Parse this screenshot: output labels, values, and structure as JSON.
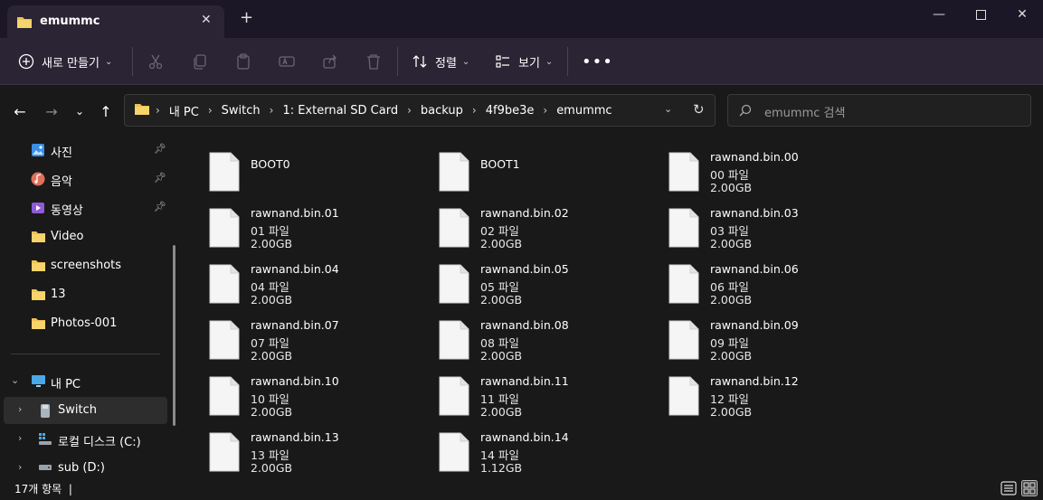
{
  "window": {
    "tab_title": "emummc",
    "new_tab_icon": "plus-icon",
    "controls": [
      "minimize-icon",
      "maximize-icon",
      "close-icon"
    ]
  },
  "toolbar": {
    "new_label": "새로 만들기",
    "sort_label": "정렬",
    "view_label": "보기",
    "more_icon": "more-icon"
  },
  "address": {
    "crumbs": [
      "내 PC",
      "Switch",
      "1: External SD Card",
      "backup",
      "4f9be3e",
      "emummc"
    ],
    "search_placeholder": "emummc 검색"
  },
  "sidebar": {
    "quick_access": [
      {
        "label": "사진",
        "icon": "pictures-icon",
        "pinned": true
      },
      {
        "label": "음악",
        "icon": "music-icon",
        "pinned": true
      },
      {
        "label": "동영상",
        "icon": "videos-icon",
        "pinned": true
      },
      {
        "label": "Video",
        "icon": "folder-icon",
        "pinned": false
      },
      {
        "label": "screenshots",
        "icon": "folder-icon",
        "pinned": false
      },
      {
        "label": "13",
        "icon": "folder-icon",
        "pinned": false
      },
      {
        "label": "Photos-001",
        "icon": "folder-icon",
        "pinned": false
      }
    ],
    "this_pc": "내 PC",
    "drives": [
      {
        "label": "Switch",
        "icon": "sd-card-icon",
        "selected": true
      },
      {
        "label": "로컬 디스크 (C:)",
        "icon": "windows-drive-icon",
        "selected": false
      },
      {
        "label": "sub (D:)",
        "icon": "drive-icon",
        "selected": false
      }
    ]
  },
  "files": [
    {
      "name": "BOOT0",
      "type": "",
      "size": ""
    },
    {
      "name": "BOOT1",
      "type": "",
      "size": ""
    },
    {
      "name": "rawnand.bin.00",
      "type": "00 파일",
      "size": "2.00GB"
    },
    {
      "name": "rawnand.bin.01",
      "type": "01 파일",
      "size": "2.00GB"
    },
    {
      "name": "rawnand.bin.02",
      "type": "02 파일",
      "size": "2.00GB"
    },
    {
      "name": "rawnand.bin.03",
      "type": "03 파일",
      "size": "2.00GB"
    },
    {
      "name": "rawnand.bin.04",
      "type": "04 파일",
      "size": "2.00GB"
    },
    {
      "name": "rawnand.bin.05",
      "type": "05 파일",
      "size": "2.00GB"
    },
    {
      "name": "rawnand.bin.06",
      "type": "06 파일",
      "size": "2.00GB"
    },
    {
      "name": "rawnand.bin.07",
      "type": "07 파일",
      "size": "2.00GB"
    },
    {
      "name": "rawnand.bin.08",
      "type": "08 파일",
      "size": "2.00GB"
    },
    {
      "name": "rawnand.bin.09",
      "type": "09 파일",
      "size": "2.00GB"
    },
    {
      "name": "rawnand.bin.10",
      "type": "10 파일",
      "size": "2.00GB"
    },
    {
      "name": "rawnand.bin.11",
      "type": "11 파일",
      "size": "2.00GB"
    },
    {
      "name": "rawnand.bin.12",
      "type": "12 파일",
      "size": "2.00GB"
    },
    {
      "name": "rawnand.bin.13",
      "type": "13 파일",
      "size": "2.00GB"
    },
    {
      "name": "rawnand.bin.14",
      "type": "14 파일",
      "size": "1.12GB"
    }
  ],
  "status": {
    "item_count": "17개 항목",
    "cursor": "|"
  },
  "colors": {
    "titlebar": "#1c1726",
    "commandbar": "#2a2434",
    "background": "#191919",
    "folder": "#f2c14e",
    "document": "#f5f5f5"
  }
}
